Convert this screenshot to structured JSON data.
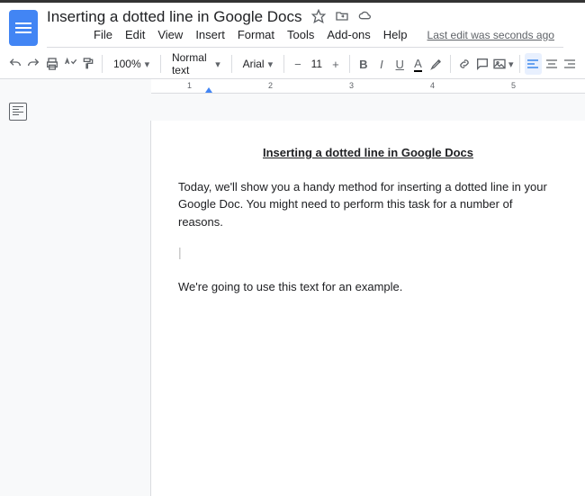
{
  "doc": {
    "title": "Inserting  a dotted line in Google Docs",
    "last_edit": "Last edit was seconds ago"
  },
  "menus": {
    "file": "File",
    "edit": "Edit",
    "view": "View",
    "insert": "Insert",
    "format": "Format",
    "tools": "Tools",
    "addons": "Add-ons",
    "help": "Help"
  },
  "toolbar": {
    "zoom": "100%",
    "style": "Normal text",
    "font": "Arial",
    "fontsize": "11"
  },
  "ruler": {
    "nums": [
      "1",
      "2",
      "3",
      "4",
      "5"
    ]
  },
  "body": {
    "heading": "Inserting a dotted line in Google Docs",
    "p1": "Today, we'll show you a handy method for inserting a dotted line in your Google Doc. You might need to perform this task for a number of reasons.",
    "p2": "We're going to use this text for an example."
  }
}
